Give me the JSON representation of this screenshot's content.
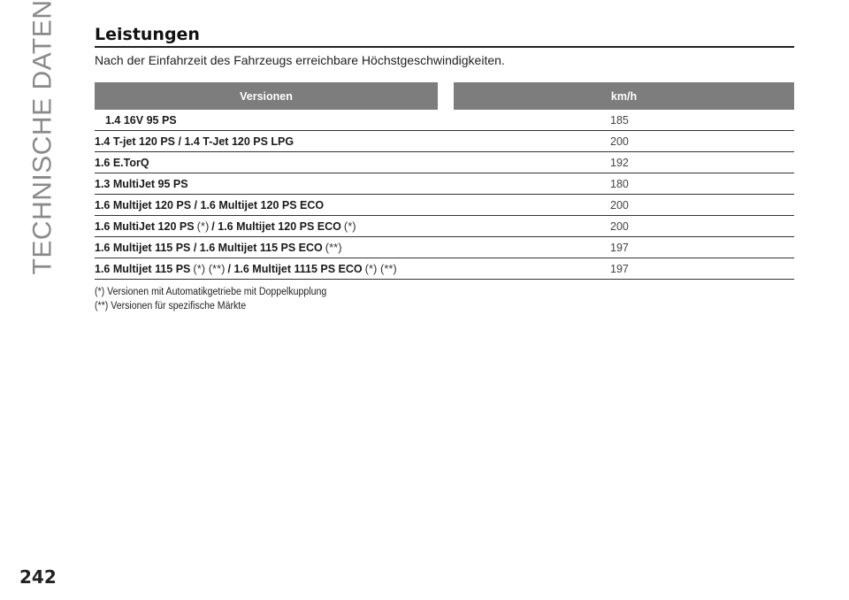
{
  "side_title": "TECHNISCHE DATEN",
  "page_number": "242",
  "heading": "Leistungen",
  "subtitle": "Nach der Einfahrzeit des Fahrzeugs erreichbare Höchstgeschwindigkeiten.",
  "table": {
    "headers": [
      "Versionen",
      "km/h"
    ],
    "rows": [
      {
        "parts": [
          {
            "text": "1.4 16V 95 PS"
          }
        ],
        "value": "185",
        "indent": true
      },
      {
        "parts": [
          {
            "text": "1.4 T-jet 120 PS / 1.4 T-Jet 120 PS LPG"
          }
        ],
        "value": "200"
      },
      {
        "parts": [
          {
            "text": "1.6 E.TorQ"
          }
        ],
        "value": "192"
      },
      {
        "parts": [
          {
            "text": "1.3 MultiJet 95 PS"
          }
        ],
        "value": "180"
      },
      {
        "parts": [
          {
            "text": "1.6 Multijet 120 PS / 1.6 Multijet 120 PS ECO"
          }
        ],
        "value": "200"
      },
      {
        "parts": [
          {
            "text": "1.6 MultiJet 120 PS"
          },
          {
            "text": "(*)",
            "sup": true
          },
          {
            "text": "/ 1.6 Multijet 120 PS ECO"
          },
          {
            "text": "(*)",
            "sup": true
          }
        ],
        "value": "200"
      },
      {
        "parts": [
          {
            "text": "1.6 Multijet 115 PS / 1.6 Multijet 115 PS ECO"
          },
          {
            "text": "(**)",
            "sup": true
          }
        ],
        "value": "197"
      },
      {
        "parts": [
          {
            "text": "1.6 Multijet 115 PS"
          },
          {
            "text": "(*) (**)",
            "sup": true
          },
          {
            "text": "/ 1.6 Multijet 1115 PS ECO"
          },
          {
            "text": "(*) (**)",
            "sup": true
          }
        ],
        "value": "197"
      }
    ]
  },
  "footnotes": [
    "(*) Versionen mit Automatikgetriebe mit Doppelkupplung",
    "(**) Versionen für spezifische Märkte"
  ]
}
